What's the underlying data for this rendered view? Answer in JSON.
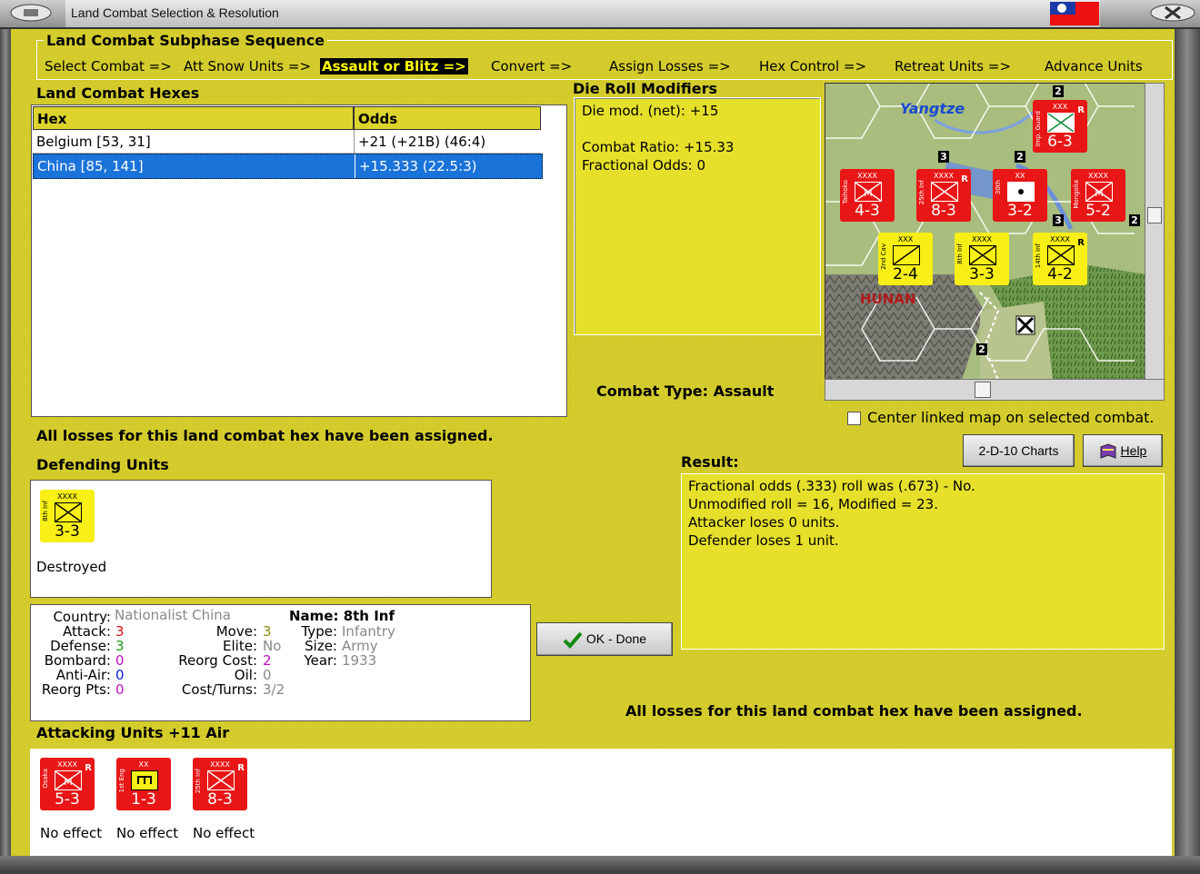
{
  "window": {
    "title": "Land Combat Selection & Resolution",
    "flag_icon": "taiwan-flag-icon"
  },
  "sequence": {
    "title": "Land Combat Subphase Sequence",
    "steps": [
      {
        "label": "Select Combat =>"
      },
      {
        "label": "Att Snow Units =>"
      },
      {
        "label": "Assault or Blitz =>",
        "active": true
      },
      {
        "label": "Convert =>"
      },
      {
        "label": "Assign Losses =>"
      },
      {
        "label": "Hex Control =>"
      },
      {
        "label": "Retreat Units =>"
      },
      {
        "label": "Advance Units"
      }
    ]
  },
  "hexes": {
    "title": "Land Combat Hexes",
    "columns": [
      "Hex",
      "Odds"
    ],
    "rows": [
      {
        "hex": "Belgium [53, 31]",
        "odds": "+21 (+21B) (46:4)"
      },
      {
        "hex": "China [85, 141]",
        "odds": "+15.333 (22.5:3)",
        "selected": true
      }
    ]
  },
  "die_roll": {
    "title": "Die Roll Modifiers",
    "lines": [
      "Die mod. (net): +15",
      "Combat Ratio: +15.33",
      "Fractional Odds: 0"
    ]
  },
  "combat_type": "Combat Type:  Assault",
  "map": {
    "labels": {
      "yangtze": "Yangtze",
      "hunan": "HUNAN"
    },
    "counters": [
      {
        "name": "Taihoku",
        "size": "XXXX",
        "str": "4-3",
        "color": "red",
        "sym": "mech"
      },
      {
        "name": "25th Inf",
        "size": "XXXX",
        "str": "8-3",
        "color": "red",
        "sym": "inf",
        "r": "R"
      },
      {
        "name": "30th",
        "size": "XX",
        "str": "3-2",
        "color": "red",
        "sym": "dot"
      },
      {
        "name": "Mongolia",
        "size": "XXXX",
        "str": "5-2",
        "color": "red",
        "sym": "mech"
      },
      {
        "name": "2nd Cav",
        "size": "XXX",
        "str": "2-4",
        "color": "yel",
        "sym": "cav"
      },
      {
        "name": "8th Inf",
        "size": "XXXX",
        "str": "3-3",
        "color": "yel",
        "sym": "inf"
      },
      {
        "name": "14th Inf",
        "size": "XXXX",
        "str": "4-2",
        "color": "yel",
        "sym": "inf",
        "r": "R"
      },
      {
        "name": "Imp. Guard",
        "size": "XXX",
        "str": "6-3",
        "color": "red",
        "sym": "guard",
        "r": "R"
      }
    ],
    "stack_counts": [
      "2",
      "3",
      "2",
      "3",
      "2",
      "2"
    ]
  },
  "center_linked": {
    "label": "Center linked map on selected combat.",
    "checked": false
  },
  "losses_msg": "All losses for this land combat hex have been assigned.",
  "buttons": {
    "charts": "2-D-10 Charts",
    "help": "Help",
    "ok": "OK - Done"
  },
  "result": {
    "title": "Result:",
    "lines": [
      "Fractional odds (.333) roll was (.673)  - No.",
      "Unmodified roll = 16, Modified = 23.",
      "Attacker loses 0 units.",
      "Defender loses 1 unit."
    ]
  },
  "defending": {
    "title": "Defending Units",
    "units": [
      {
        "name": "8th Inf",
        "size": "XXXX",
        "str": "3-3",
        "color": "yel",
        "sym": "inf",
        "status": "Destroyed"
      }
    ]
  },
  "unit_info": {
    "country_k": "Country:",
    "country": "Nationalist China",
    "attack_k": "Attack:",
    "attack": "3",
    "defense_k": "Defense:",
    "defense": "3",
    "bombard_k": "Bombard:",
    "bombard": "0",
    "antiair_k": "Anti-Air:",
    "antiair": "0",
    "reorgpts_k": "Reorg Pts:",
    "reorgpts": "0",
    "move_k": "Move:",
    "move": "3",
    "elite_k": "Elite:",
    "elite": "No",
    "reorgcost_k": "Reorg Cost:",
    "reorgcost": "2",
    "oil_k": "Oil:",
    "oil": "0",
    "costturns_k": "Cost/Turns:",
    "costturns": "3/2",
    "name": "Name: 8th Inf",
    "type_k": "Type:",
    "type": "Infantry",
    "size_k": "Size:",
    "size": "Army",
    "year_k": "Year:",
    "year": "1933"
  },
  "attacking": {
    "title": "Attacking Units +11 Air",
    "units": [
      {
        "name": "Osaka",
        "size": "XXXX",
        "str": "5-3",
        "color": "red",
        "sym": "mech",
        "r": "R",
        "status": "No effect"
      },
      {
        "name": "1st Eng",
        "size": "XX",
        "str": "1-3",
        "color": "red",
        "sym": "eng",
        "status": "No effect"
      },
      {
        "name": "25th Inf",
        "size": "XXXX",
        "str": "8-3",
        "color": "red",
        "sym": "inf",
        "r": "R",
        "status": "No effect"
      }
    ]
  },
  "colors": {
    "panel": "#d4cc2c",
    "selection": "#1a73d9",
    "attack": "#e81616",
    "defend": "#f7ef16"
  }
}
